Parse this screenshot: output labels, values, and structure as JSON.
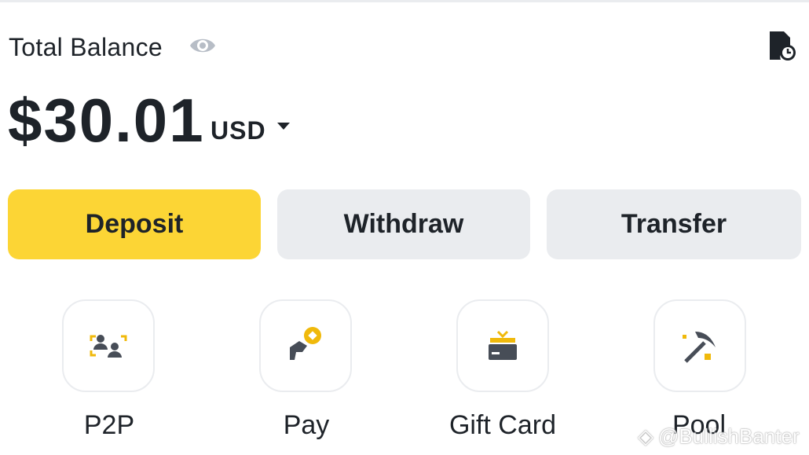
{
  "header": {
    "balance_label": "Total Balance",
    "eye_icon": "eye-icon",
    "history_icon": "history-icon"
  },
  "balance": {
    "amount": "$30.01",
    "currency": "USD"
  },
  "actions": {
    "deposit": "Deposit",
    "withdraw": "Withdraw",
    "transfer": "Transfer"
  },
  "shortcuts": [
    {
      "label": "P2P",
      "icon": "p2p-icon"
    },
    {
      "label": "Pay",
      "icon": "pay-icon"
    },
    {
      "label": "Gift Card",
      "icon": "gift-card-icon"
    },
    {
      "label": "Pool",
      "icon": "pickaxe-icon"
    }
  ],
  "watermark": "@BullishBanter",
  "colors": {
    "accent": "#fcd535",
    "button_gray": "#eaecef",
    "text": "#1e2329"
  }
}
